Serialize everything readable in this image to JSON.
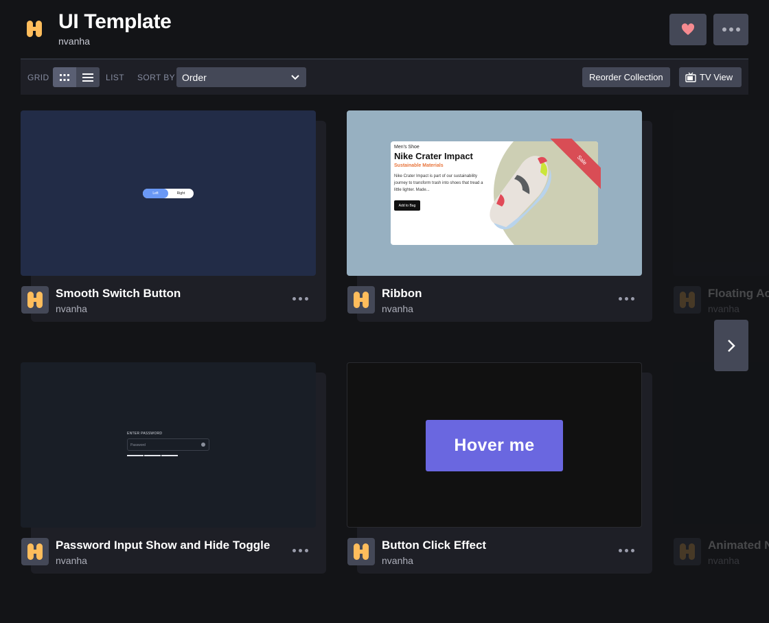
{
  "header": {
    "title": "UI Template",
    "author": "nvanha",
    "like_icon": "heart-icon",
    "more_icon": "more-icon"
  },
  "toolbar": {
    "grid_label": "GRID",
    "list_label": "LIST",
    "sort_label": "SORT BY",
    "sort_value": "Order",
    "reorder_label": "Reorder Collection",
    "tv_view_label": "TV View"
  },
  "colors": {
    "background": "#131417",
    "panel": "#1e1f26",
    "button": "#444857",
    "avatar_logo": "#ffbd5c",
    "heart": "#f58a90",
    "accent_button": "#6a67e0"
  },
  "cards": [
    {
      "title": "Smooth Switch Button",
      "author": "nvanha",
      "preview": {
        "left": "Left",
        "right": "Right"
      }
    },
    {
      "title": "Ribbon",
      "author": "nvanha",
      "preview": {
        "small": "Men's Shoe",
        "title": "Nike Crater Impact",
        "subtitle": "Sustainable Materials",
        "description": "Nike Crater Impact is part of our sustainability journey to transform trash into shoes that tread a little lighter. Made...",
        "button": "Add to Bag",
        "ribbon": "Sale"
      }
    },
    {
      "title": "Floating Ac",
      "author": "nvanha"
    },
    {
      "title": "Password Input Show and Hide Toggle",
      "author": "nvanha",
      "preview": {
        "label": "ENTER PASSWORD",
        "placeholder": "Password"
      }
    },
    {
      "title": "Button Click Effect",
      "author": "nvanha",
      "preview": {
        "button": "Hover me"
      }
    },
    {
      "title": "Animated N",
      "author": "nvanha"
    }
  ]
}
